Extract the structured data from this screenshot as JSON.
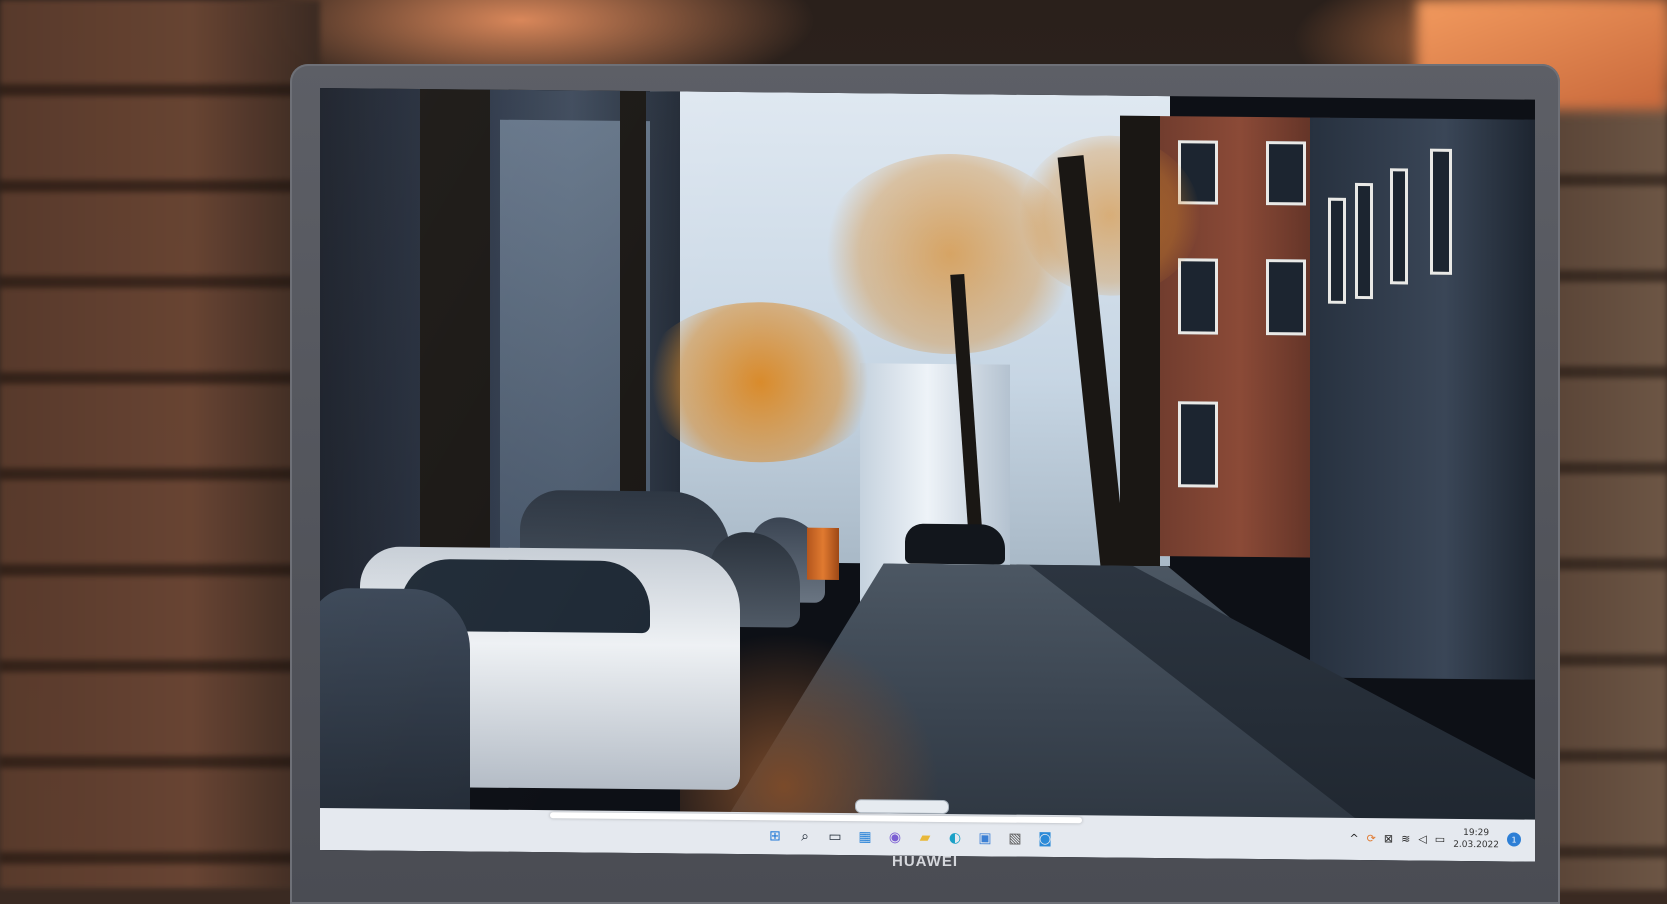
{
  "device": {
    "brand": "HUAWEI"
  },
  "taskbar": {
    "icons": [
      {
        "name": "windows-start-icon",
        "glyph": "⊞"
      },
      {
        "name": "search-icon",
        "glyph": "⌕"
      },
      {
        "name": "task-view-icon",
        "glyph": "▭"
      },
      {
        "name": "widgets-icon",
        "glyph": "▦"
      },
      {
        "name": "chat-icon",
        "glyph": "◉"
      },
      {
        "name": "file-explorer-icon",
        "glyph": "▰"
      },
      {
        "name": "edge-browser-icon",
        "glyph": "◐"
      },
      {
        "name": "store-icon",
        "glyph": "▣"
      },
      {
        "name": "app-icon",
        "glyph": "▧"
      },
      {
        "name": "app2-icon",
        "glyph": "◙"
      }
    ],
    "tray": {
      "chevron": "^",
      "time": "19:29",
      "date": "2.03.2022",
      "notification_count": "1"
    }
  },
  "colors": {
    "taskbar_bg": "#e5e9ef",
    "accent": "#2d7fd6",
    "bezel": "#4f5158"
  }
}
